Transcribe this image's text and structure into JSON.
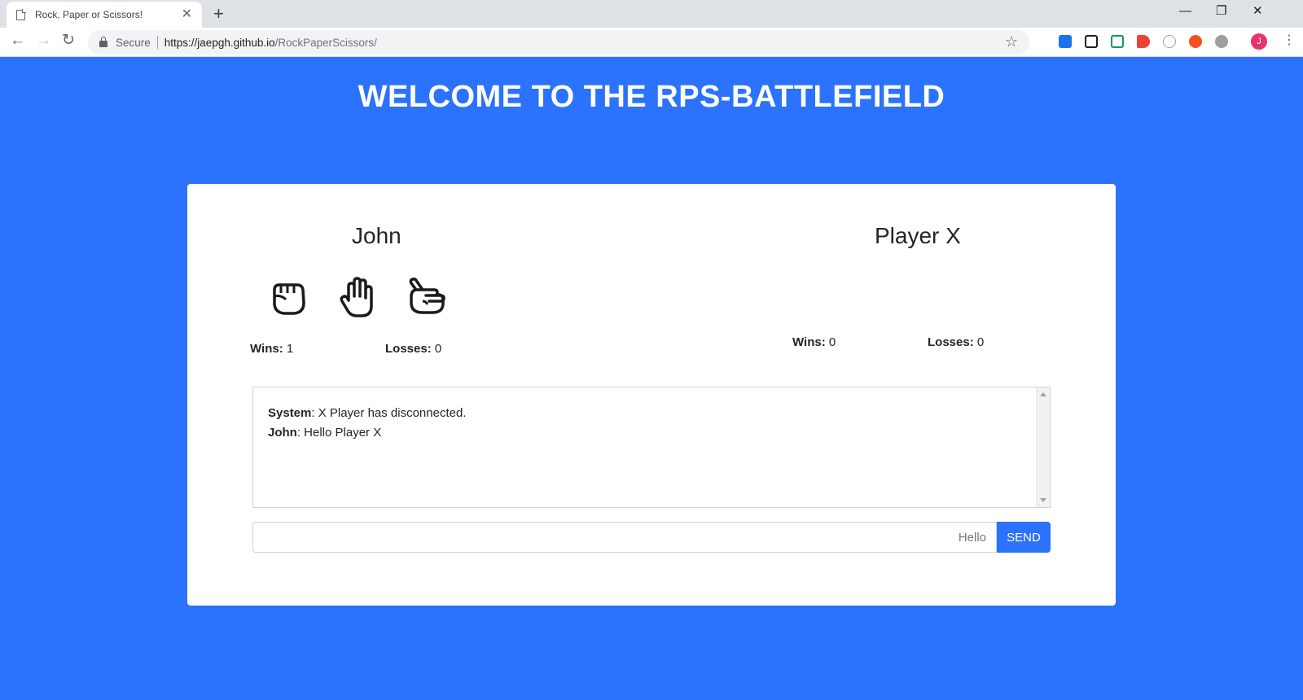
{
  "browser": {
    "tab_title": "Rock, Paper or Scissors!",
    "new_tab": "+",
    "security_label": "Secure",
    "url_host": "https://jaepgh.github.io",
    "url_path": "/RockPaperScissors/",
    "avatar_initial": "J",
    "window_controls": {
      "minimize": "—",
      "restore": "❐",
      "close": "✕"
    },
    "extension_colors": [
      "#1a73e8",
      "#202124",
      "#0f9d58",
      "#ea4335",
      "#9aa0a6",
      "#f4511e",
      "#9e9e9e"
    ]
  },
  "page": {
    "heading": "WELCOME TO THE RPS-BATTLEFIELD",
    "accent_color": "#2b72fc"
  },
  "player1": {
    "name": "John",
    "choices": [
      "rock-icon",
      "paper-icon",
      "scissors-icon"
    ],
    "wins_label": "Wins:",
    "wins": "1",
    "losses_label": "Losses:",
    "losses": "0"
  },
  "player2": {
    "name": "Player X",
    "wins_label": "Wins:",
    "wins": "0",
    "losses_label": "Losses:",
    "losses": "0"
  },
  "chat": {
    "messages": [
      {
        "sender": "System",
        "text": ": X Player has disconnected."
      },
      {
        "sender": "John",
        "text": ": Hello Player X"
      }
    ],
    "input_placeholder": "Hello",
    "send_label": "SEND"
  }
}
